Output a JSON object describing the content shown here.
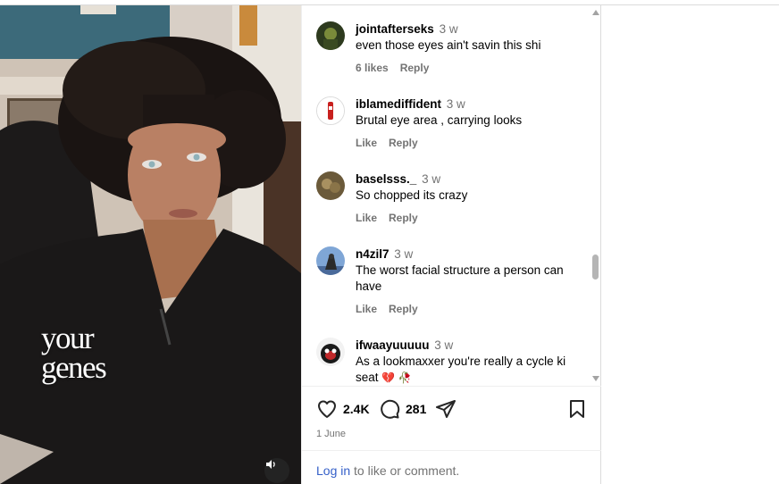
{
  "video": {
    "overlay_line1": "your",
    "overlay_line2": "genes",
    "mute_icon": "speaker-icon"
  },
  "comments": [
    {
      "username": "jointafterseks",
      "time": "3 w",
      "text": "even those eyes ain't savin this shi",
      "likes": "6 likes",
      "reply": "Reply",
      "avatar_color": "#2d3a1e"
    },
    {
      "username": "iblamediffident",
      "time": "3 w",
      "text": "Brutal eye area , carrying looks",
      "likes": "Like",
      "reply": "Reply",
      "avatar_color": "#c8201e"
    },
    {
      "username": "baselsss._",
      "time": "3 w",
      "text": "So chopped its crazy",
      "likes": "Like",
      "reply": "Reply",
      "avatar_color": "#6b5a3a"
    },
    {
      "username": "n4zil7",
      "time": "3 w",
      "text": "The worst facial structure a person can have",
      "likes": "Like",
      "reply": "Reply",
      "avatar_color": "#6a8fbf"
    },
    {
      "username": "ifwaayuuuuu",
      "time": "3 w",
      "text": "As a lookmaxxer you're really a cycle ki seat",
      "emoji": "💔 🥀",
      "likes": "Like",
      "reply": "Reply",
      "avatar_color": "#c0282a"
    }
  ],
  "actions": {
    "like_count": "2.4K",
    "comment_count": "281",
    "date": "1 June"
  },
  "login": {
    "link": "Log in",
    "rest": " to like or comment."
  }
}
